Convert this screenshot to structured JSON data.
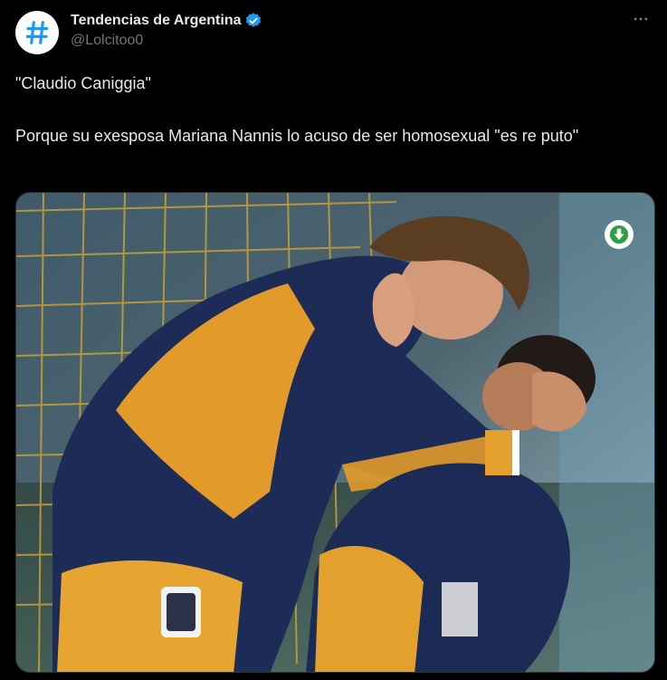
{
  "account": {
    "display_name": "Tendencias de Argentina",
    "handle": "@Lolcitoo0",
    "avatar_icon": "hashtag-icon",
    "verified_icon": "verified-badge-icon"
  },
  "tweet": {
    "line1": "\"Claudio Caniggia\"",
    "line2": "Porque su exesposa Mariana Nannis lo acuso de ser homosexual \"es re puto\""
  },
  "media": {
    "download_icon": "download-arrow-icon"
  },
  "colors": {
    "accent": "#1d9bf0",
    "background": "#000000",
    "text": "#e7e9ea",
    "muted": "#71767b",
    "download_green": "#2ea043"
  }
}
